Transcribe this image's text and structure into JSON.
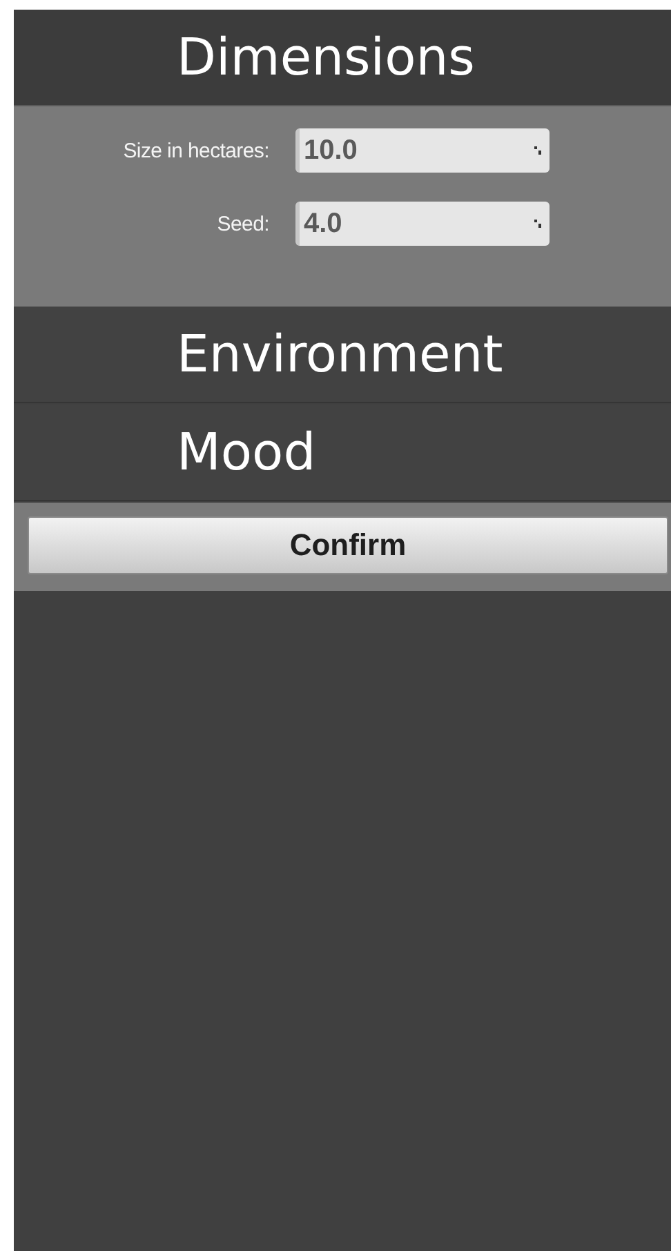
{
  "sections": [
    {
      "title": "Dimensions",
      "expanded": true,
      "fields": [
        {
          "label": "Size in hectares:",
          "value": "10.0"
        },
        {
          "label": "Seed:",
          "value": "4.0"
        }
      ]
    },
    {
      "title": "Environment",
      "expanded": false
    },
    {
      "title": "Mood",
      "expanded": false
    }
  ],
  "confirm_button": "Confirm"
}
